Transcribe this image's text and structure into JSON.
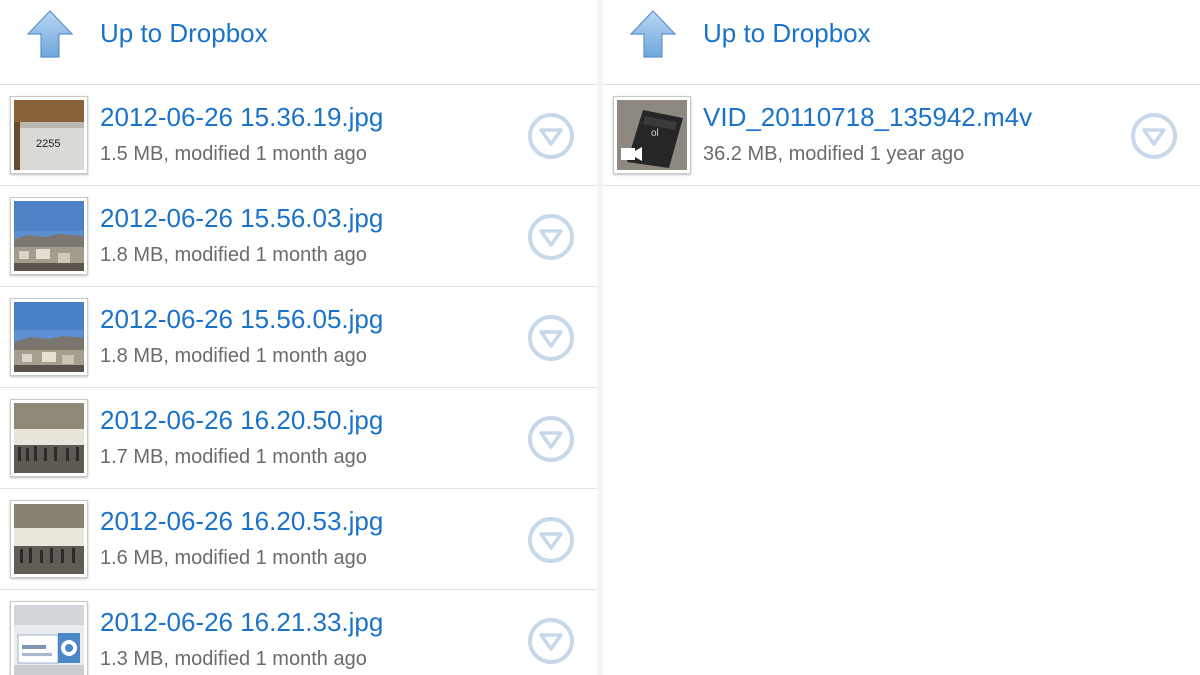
{
  "left_panel": {
    "up_label": "Up to Dropbox",
    "icons": {
      "up": "up-arrow-icon",
      "menu": "chevron-down-circle-icon"
    },
    "files": [
      {
        "name": "2012-06-26 15.36.19.jpg",
        "meta": "1.5 MB, modified 1 month ago",
        "thumb": "photo-thumbnail-sign"
      },
      {
        "name": "2012-06-26 15.56.03.jpg",
        "meta": "1.8 MB, modified 1 month ago",
        "thumb": "photo-thumbnail-city"
      },
      {
        "name": "2012-06-26 15.56.05.jpg",
        "meta": "1.8 MB, modified 1 month ago",
        "thumb": "photo-thumbnail-city"
      },
      {
        "name": "2012-06-26 16.20.50.jpg",
        "meta": "1.7 MB, modified 1 month ago",
        "thumb": "photo-thumbnail-hall"
      },
      {
        "name": "2012-06-26 16.20.53.jpg",
        "meta": "1.6 MB, modified 1 month ago",
        "thumb": "photo-thumbnail-hall"
      },
      {
        "name": "2012-06-26 16.21.33.jpg",
        "meta": "1.3 MB, modified 1 month ago",
        "thumb": "photo-thumbnail-banner"
      }
    ]
  },
  "right_panel": {
    "up_label": "Up to Dropbox",
    "files": [
      {
        "name": "VID_20110718_135942.m4v",
        "meta": "36.2 MB, modified 1 year ago",
        "thumb": "video-thumbnail"
      }
    ]
  },
  "colors": {
    "link_blue": "#1a73c9",
    "meta_gray": "#6b6b6b",
    "divider": "#e3e3e3",
    "menu_circle": "#c7d8ea",
    "up_arrow": "#7fb2e2"
  }
}
